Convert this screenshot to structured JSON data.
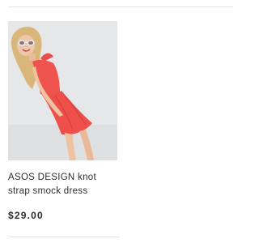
{
  "product": {
    "image_alt": "Woman wearing coral knot strap smock dress and white sunglasses",
    "title": "ASOS DESIGN knot strap smock dress",
    "price": "$29.00",
    "dress_color": "#f0544f"
  }
}
